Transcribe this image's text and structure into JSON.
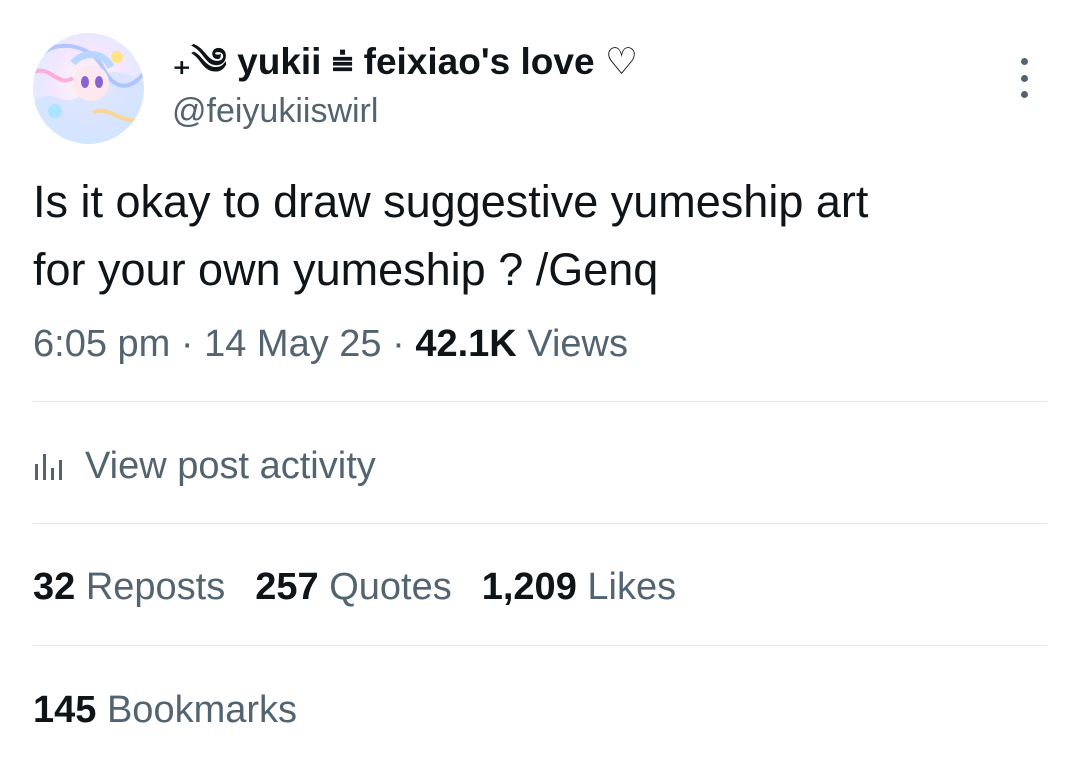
{
  "author": {
    "display_name": "₊༄ yukii ⩧ feixiao's love ♡",
    "handle": "@feiyukiiswirl",
    "avatar_icon": "avatar-illustration"
  },
  "menu_icon": "more-vertical-icon",
  "post": {
    "line1": "Is it okay to draw suggestive yumeship art",
    "line2": "for your own yumeship ? /Genq"
  },
  "meta": {
    "time": "6:05 pm",
    "sep1": " · ",
    "date": "14 May 25",
    "sep2": " · ",
    "views_count": "42.1K",
    "views_label": " Views"
  },
  "activity": {
    "icon": "bar-chart-icon",
    "label": "View post activity"
  },
  "stats": {
    "reposts_count": "32",
    "reposts_label": " Reposts",
    "quotes_count": "257",
    "quotes_label": " Quotes",
    "likes_count": "1,209",
    "likes_label": " Likes",
    "bookmarks_count": "145",
    "bookmarks_label": " Bookmarks"
  },
  "colors": {
    "text_primary": "#0f1419",
    "text_secondary": "#536471",
    "divider": "#e1e6ea"
  }
}
